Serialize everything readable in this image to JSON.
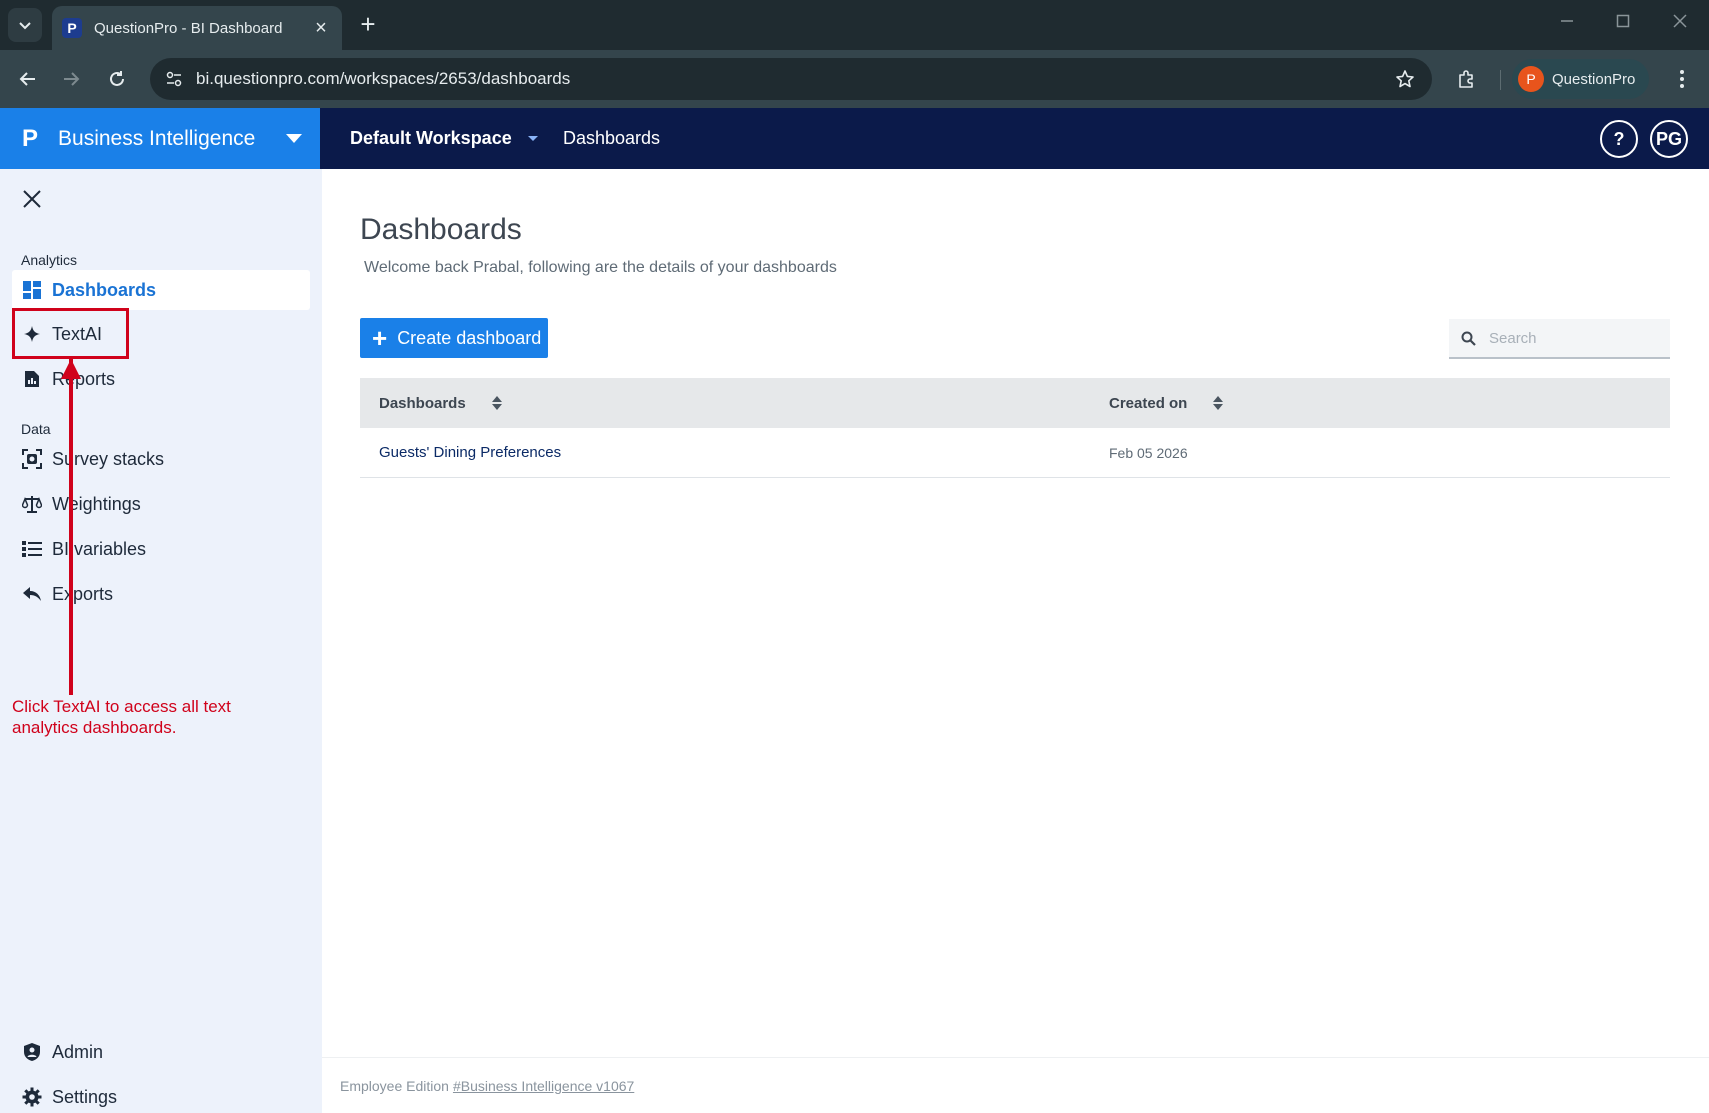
{
  "browser": {
    "tab_title": "QuestionPro - BI Dashboard",
    "tab_favicon": "P",
    "url": "bi.questionpro.com/workspaces/2653/dashboards",
    "profile_initial": "P",
    "profile_name": "QuestionPro"
  },
  "header": {
    "brand_logo": "P",
    "brand_name": "Business Intelligence",
    "workspace": "Default Workspace",
    "nav_link": "Dashboards",
    "help_label": "?",
    "user_initials": "PG"
  },
  "sidebar": {
    "section_analytics": "Analytics",
    "section_data": "Data",
    "items": {
      "dashboards": "Dashboards",
      "textai": "TextAI",
      "reports": "Reports",
      "survey_stacks": "Survey stacks",
      "weightings": "Weightings",
      "bi_variables": "BI variables",
      "exports": "Exports",
      "admin": "Admin",
      "settings": "Settings"
    }
  },
  "annotation": {
    "text": "Click TextAI to access all text analytics dashboards.",
    "color": "#d0021b"
  },
  "main": {
    "title": "Dashboards",
    "subtitle": "Welcome back Prabal, following are the details of your dashboards",
    "create_button": "Create dashboard",
    "search_placeholder": "Search",
    "table": {
      "col_name": "Dashboards",
      "col_created": "Created on",
      "rows": [
        {
          "name": "Guests' Dining Preferences",
          "created": "Feb 05 2026"
        }
      ]
    },
    "footer_prefix": "Employee Edition",
    "footer_link": "#Business Intelligence v1067"
  },
  "colors": {
    "brand_blue": "#1a80e8",
    "header_navy": "#0b1a4a",
    "sidebar_bg": "#edf2fb"
  }
}
